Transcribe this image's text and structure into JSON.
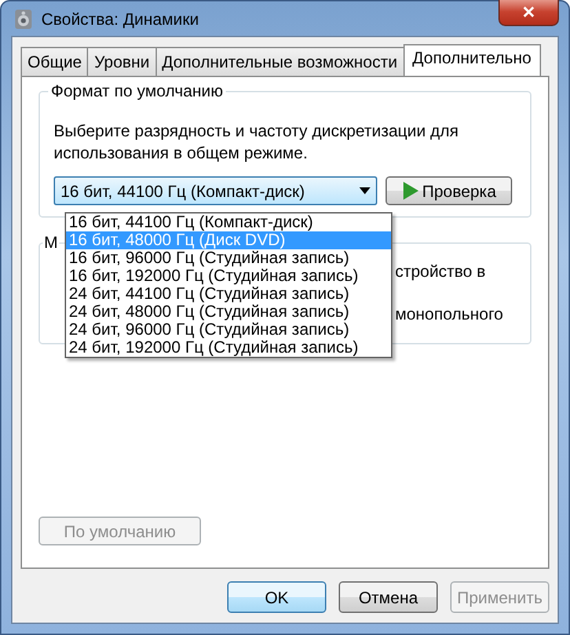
{
  "window": {
    "title": "Свойства: Динамики",
    "close": "✕"
  },
  "tabs": [
    {
      "label": "Общие",
      "selected": false
    },
    {
      "label": "Уровни",
      "selected": false
    },
    {
      "label": "Дополнительные возможности",
      "selected": false
    },
    {
      "label": "Дополнительно",
      "selected": true
    }
  ],
  "default_format": {
    "title": "Формат по умолчанию",
    "description": "Выберите разрядность и частоту дискретизации для использования в общем режиме.",
    "combo": {
      "value": "16 бит, 44100 Гц (Компакт-диск)",
      "expanded": true
    },
    "options": [
      {
        "label": "16 бит, 44100 Гц (Компакт-диск)",
        "selected": false
      },
      {
        "label": "16 бит, 48000 Гц (Диск DVD)",
        "selected": true
      },
      {
        "label": "16 бит, 96000 Гц (Студийная запись)",
        "selected": false
      },
      {
        "label": "16 бит, 192000 Гц (Студийная запись)",
        "selected": false
      },
      {
        "label": "24 бит, 44100 Гц (Студийная запись)",
        "selected": false
      },
      {
        "label": "24 бит, 48000 Гц (Студийная запись)",
        "selected": false
      },
      {
        "label": "24 бит, 96000 Гц (Студийная запись)",
        "selected": false
      },
      {
        "label": "24 бит, 192000 Гц (Студийная запись)",
        "selected": false
      }
    ],
    "test_button": {
      "label": "Проверка"
    }
  },
  "exclusive_group": {
    "title": "М",
    "lines": [
      "стройство в",
      "монопольного"
    ]
  },
  "restore_button": {
    "label": "По умолчанию",
    "disabled": true
  },
  "buttons": [
    {
      "label": "OK",
      "default": true,
      "disabled": false
    },
    {
      "label": "Отмена",
      "default": false,
      "disabled": false
    },
    {
      "label": "Применить",
      "default": false,
      "disabled": true
    }
  ]
}
